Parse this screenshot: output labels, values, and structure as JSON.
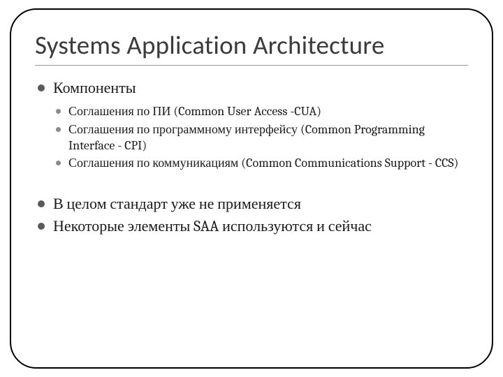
{
  "title": "Systems Application Architecture",
  "bullets": {
    "components": {
      "label": "Компоненты",
      "items": [
        "Соглашения по ПИ (Common User Access -CUA)",
        "Соглашения по программному интерфейсу (Common Programming Interface - CPI)",
        "Соглашения по коммуникациям (Common Communications Support - CCS)"
      ]
    },
    "note1": "В целом стандарт уже не применяется",
    "note2": "Некоторые элементы SAA используются и сейчас"
  }
}
